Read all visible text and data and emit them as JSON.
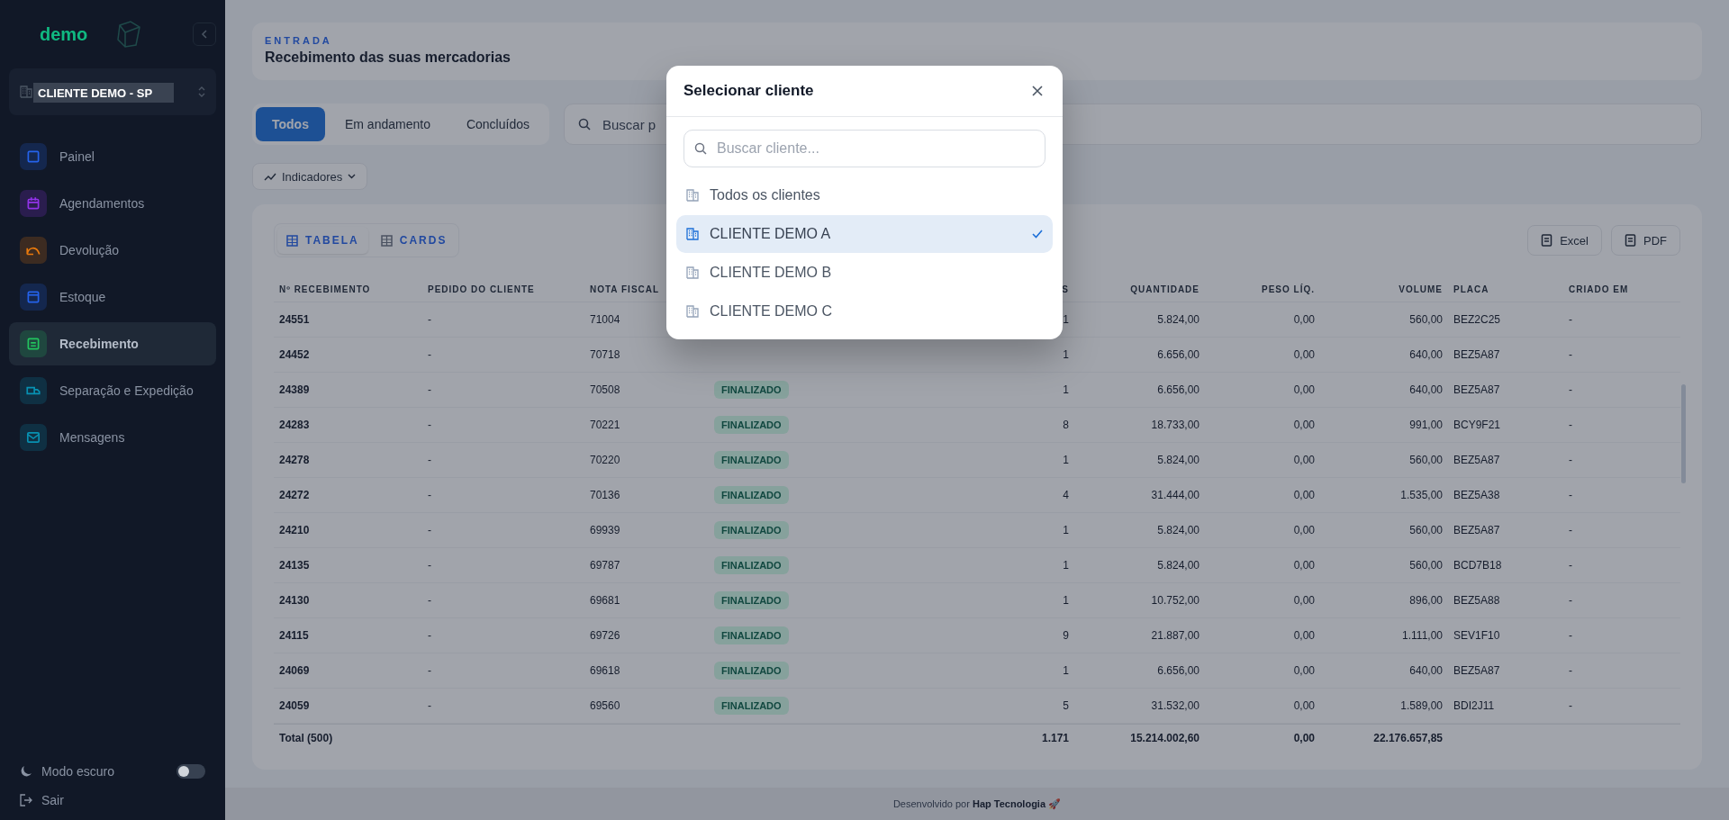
{
  "sidebar": {
    "logo": "demo",
    "client_tooltip": "CLIENTE DEMO - SP",
    "items": [
      {
        "label": "Painel",
        "kind": "panel",
        "color": "#2563eb",
        "selected": false
      },
      {
        "label": "Agendamentos",
        "kind": "calendar",
        "color": "#9333ea",
        "selected": false
      },
      {
        "label": "Devolução",
        "kind": "return",
        "color": "#ea7a0c",
        "selected": false
      },
      {
        "label": "Estoque",
        "kind": "box",
        "color": "#2563eb",
        "selected": false
      },
      {
        "label": "Recebimento",
        "kind": "receipt",
        "color": "#22c55e",
        "selected": true
      },
      {
        "label": "Separação e Expedição",
        "kind": "truck",
        "color": "#0891b2",
        "selected": false
      },
      {
        "label": "Mensagens",
        "kind": "message",
        "color": "#0891b2",
        "selected": false
      }
    ],
    "dark_mode": {
      "label": "Modo escuro",
      "on": false
    },
    "logout": "Sair"
  },
  "header": {
    "eyebrow": "ENTRADA",
    "title": "Recebimento das suas mercadorias"
  },
  "filters": {
    "tabs": [
      {
        "label": "Todos",
        "selected": true
      },
      {
        "label": "Em andamento",
        "selected": false
      },
      {
        "label": "Concluídos",
        "selected": false
      }
    ],
    "search": {
      "placeholder": "Buscar p"
    }
  },
  "indicators": {
    "label": "Indicadores"
  },
  "table": {
    "views": [
      {
        "label": "TABELA",
        "selected": true
      },
      {
        "label": "CARDS",
        "selected": false
      }
    ],
    "exports": [
      "Excel",
      "PDF"
    ],
    "columns": [
      "Nº RECEBIMENTO",
      "PEDIDO DO CLIENTE",
      "NOTA FISCAL",
      "S",
      "QUANTIDADE",
      "PESO LÍQ.",
      "VOLUME",
      "PLACA",
      "CRIADO EM"
    ],
    "rows": [
      {
        "cells": [
          "24551",
          "-",
          "71004",
          "1",
          "5.824,00",
          "0,00",
          "560,00",
          "BEZ2C25",
          "-"
        ]
      },
      {
        "cells": [
          "24452",
          "-",
          "70718",
          "1",
          "6.656,00",
          "0,00",
          "640,00",
          "BEZ5A87",
          "-"
        ]
      },
      {
        "cells": [
          "24389",
          "-",
          "70508",
          "1",
          "6.656,00",
          "0,00",
          "640,00",
          "BEZ5A87",
          "-"
        ],
        "status": "FINALIZADO"
      },
      {
        "cells": [
          "24283",
          "-",
          "70221",
          "8",
          "18.733,00",
          "0,00",
          "991,00",
          "BCY9F21",
          "-"
        ],
        "status": "FINALIZADO"
      },
      {
        "cells": [
          "24278",
          "-",
          "70220",
          "1",
          "5.824,00",
          "0,00",
          "560,00",
          "BEZ5A87",
          "-"
        ],
        "status": "FINALIZADO"
      },
      {
        "cells": [
          "24272",
          "-",
          "70136",
          "4",
          "31.444,00",
          "0,00",
          "1.535,00",
          "BEZ5A38",
          "-"
        ],
        "status": "FINALIZADO"
      },
      {
        "cells": [
          "24210",
          "-",
          "69939",
          "1",
          "5.824,00",
          "0,00",
          "560,00",
          "BEZ5A87",
          "-"
        ],
        "status": "FINALIZADO"
      },
      {
        "cells": [
          "24135",
          "-",
          "69787",
          "1",
          "5.824,00",
          "0,00",
          "560,00",
          "BCD7B18",
          "-"
        ],
        "status": "FINALIZADO"
      },
      {
        "cells": [
          "24130",
          "-",
          "69681",
          "1",
          "10.752,00",
          "0,00",
          "896,00",
          "BEZ5A88",
          "-"
        ],
        "status": "FINALIZADO"
      },
      {
        "cells": [
          "24115",
          "-",
          "69726",
          "9",
          "21.887,00",
          "0,00",
          "1.111,00",
          "SEV1F10",
          "-"
        ],
        "status": "FINALIZADO"
      },
      {
        "cells": [
          "24069",
          "-",
          "69618",
          "1",
          "6.656,00",
          "0,00",
          "640,00",
          "BEZ5A87",
          "-"
        ],
        "status": "FINALIZADO"
      },
      {
        "cells": [
          "24059",
          "-",
          "69560",
          "5",
          "31.532,00",
          "0,00",
          "1.589,00",
          "BDI2J11",
          "-"
        ],
        "status": "FINALIZADO"
      }
    ],
    "total": {
      "label": "Total (500)",
      "values": [
        "1.171",
        "15.214.002,60",
        "0,00",
        "22.176.657,85"
      ]
    }
  },
  "footer": {
    "credit": "Desenvolvido por **Hap Tecnologia** 🚀"
  },
  "modal": {
    "title": "Selecionar cliente",
    "search": {
      "placeholder": "Buscar cliente..."
    },
    "options": [
      {
        "label": "Todos os clientes",
        "selected": false
      },
      {
        "label": "CLIENTE DEMO A",
        "selected": true
      },
      {
        "label": "CLIENTE DEMO B",
        "selected": false
      },
      {
        "label": "CLIENTE DEMO C",
        "selected": false
      }
    ]
  }
}
